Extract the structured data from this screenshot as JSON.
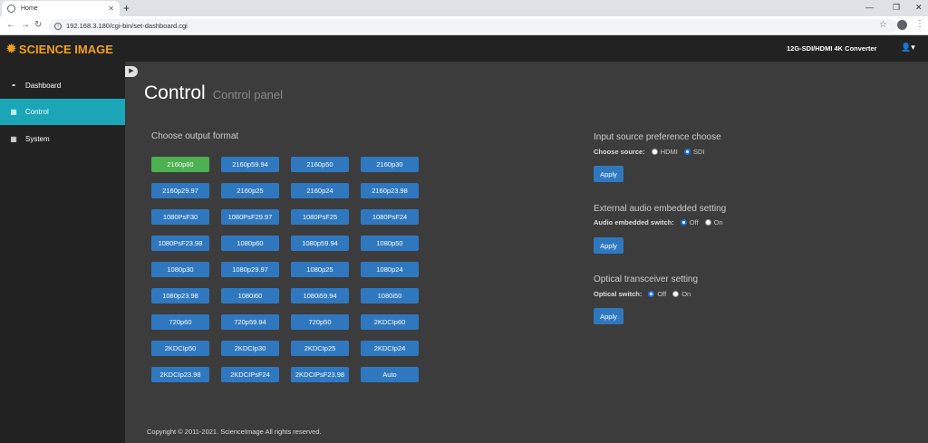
{
  "browser": {
    "tab_title": "Home",
    "new_tab": "+",
    "url": "192.168.3.180/cgi-bin/set-dashboard.cgi"
  },
  "header": {
    "brand": "SCIENCE IMAGE",
    "product": "12G-SDI/HDMI 4K Converter"
  },
  "sidebar": {
    "items": [
      {
        "label": "Dashboard"
      },
      {
        "label": "Control"
      },
      {
        "label": "System"
      }
    ]
  },
  "page": {
    "title": "Control",
    "subtitle": "Control panel"
  },
  "output_format": {
    "title": "Choose output format",
    "selected": "2160p60",
    "buttons": [
      "2160p60",
      "2160p59.94",
      "2160p50",
      "2160p30",
      "2160p29.97",
      "2160p25",
      "2160p24",
      "2160p23.98",
      "1080PsF30",
      "1080PsF29.97",
      "1080PsF25",
      "1080PsF24",
      "1080PsF23.98",
      "1080p60",
      "1080p59.94",
      "1080p50",
      "1080p30",
      "1080p29.97",
      "1080p25",
      "1080p24",
      "1080p23.98",
      "1080i60",
      "1080i59.94",
      "1080i50",
      "720p60",
      "720p59.94",
      "720p50",
      "2KDCIp60",
      "2KDCIp50",
      "2KDCIp30",
      "2KDCIp25",
      "2KDCIp24",
      "2KDCIp23.98",
      "2KDCIPsF24",
      "2KDCIPsF23.98",
      "Auto"
    ]
  },
  "input_source": {
    "title": "Input source preference choose",
    "label": "Choose source:",
    "options": [
      "HDMI",
      "SDI"
    ],
    "selected": "SDI",
    "apply": "Apply"
  },
  "audio": {
    "title": "External audio embedded setting",
    "label": "Audio embedded switch:",
    "options": [
      "Off",
      "On"
    ],
    "selected": "Off",
    "apply": "Apply"
  },
  "optical": {
    "title": "Optical transceiver setting",
    "label": "Optical switch:",
    "options": [
      "Off",
      "On"
    ],
    "selected": "Off",
    "apply": "Apply"
  },
  "footer": {
    "copyright": "Copyright © 2011-2021. ScienceImage All rights reserved."
  },
  "colors": {
    "accent": "#1aa6b7",
    "brand": "#f0a020",
    "button": "#2f78c0",
    "selected": "#4caf50"
  }
}
